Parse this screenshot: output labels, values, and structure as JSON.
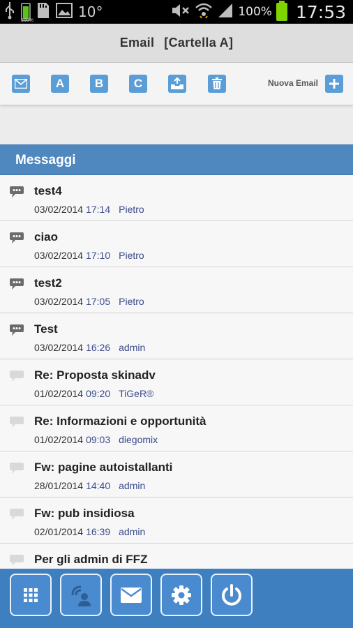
{
  "status_bar": {
    "battery_small_label": "100%",
    "temperature": "10°",
    "battery_percent": "100%",
    "time": "17:53"
  },
  "header": {
    "title": "Email",
    "folder": "[Cartella A]"
  },
  "toolbar": {
    "folder_a": "A",
    "folder_b": "B",
    "folder_c": "C",
    "new_email_label": "Nuova Email"
  },
  "messages": {
    "section_title": "Messaggi",
    "items": [
      {
        "subject": "test4",
        "date": "03/02/2014",
        "time": "17:14",
        "author": "Pietro",
        "read": false
      },
      {
        "subject": "ciao",
        "date": "03/02/2014",
        "time": "17:10",
        "author": "Pietro",
        "read": false
      },
      {
        "subject": "test2",
        "date": "03/02/2014",
        "time": "17:05",
        "author": "Pietro",
        "read": false
      },
      {
        "subject": "Test",
        "date": "03/02/2014",
        "time": "16:26",
        "author": "admin",
        "read": false
      },
      {
        "subject": "Re: Proposta skinadv",
        "date": "01/02/2014",
        "time": "09:20",
        "author": "TiGeR®",
        "read": true
      },
      {
        "subject": "Re: Informazioni e opportunità",
        "date": "01/02/2014",
        "time": "09:03",
        "author": "diegomix",
        "read": true
      },
      {
        "subject": "Fw: pagine autoistallanti",
        "date": "28/01/2014",
        "time": "14:40",
        "author": "admin",
        "read": true
      },
      {
        "subject": "Fw: pub insidiosa",
        "date": "02/01/2014",
        "time": "16:39",
        "author": "admin",
        "read": true
      },
      {
        "subject": "Per gli admin di FFZ",
        "date": "",
        "time": "",
        "author": "",
        "read": true
      }
    ]
  },
  "colors": {
    "accent": "#4f87bf",
    "nav_bar": "#3e7fbf",
    "unread_bubble": "#6b6b6b",
    "read_bubble": "#d9d9d9"
  },
  "bottom_nav": [
    "grid-icon",
    "contacts-icon",
    "mail-icon",
    "settings-icon",
    "power-icon"
  ]
}
